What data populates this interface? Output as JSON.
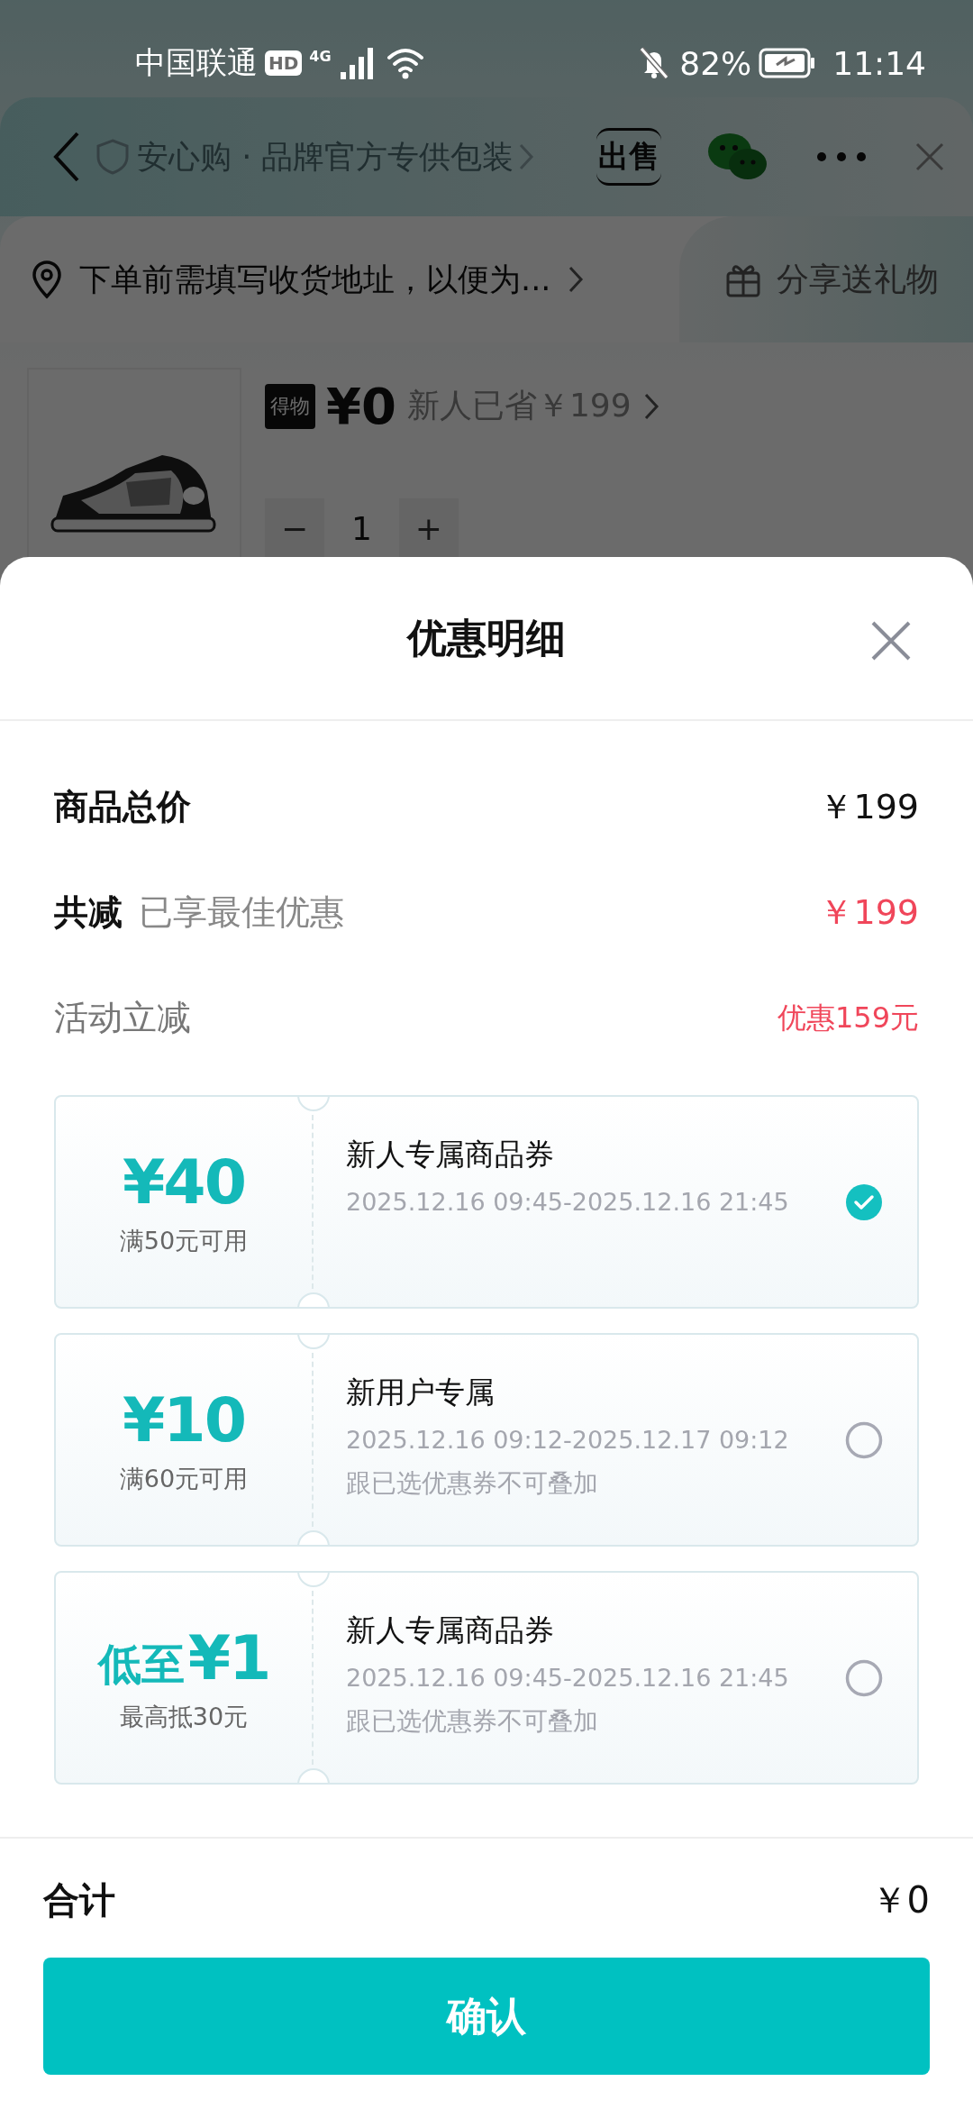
{
  "status_bar": {
    "carrier": "中国联通",
    "hd": "HD",
    "network": "4G",
    "battery": "82%",
    "time": "11:14"
  },
  "header": {
    "badge_text": "安心购 · 品牌官方专供包装",
    "sell_label": "出售"
  },
  "address_bar": {
    "text": "下单前需填写收货地址，以便为...",
    "share": "分享送礼物"
  },
  "product": {
    "brand_logo": "得物",
    "price": "¥0",
    "saved": "新人已省￥199",
    "minus": "−",
    "quantity": "1",
    "plus": "+"
  },
  "sheet": {
    "title": "优惠明细",
    "summary": [
      {
        "kind": "total",
        "label": "商品总价",
        "value": "￥199"
      },
      {
        "kind": "discount",
        "label": "共减",
        "note": "已享最佳优惠",
        "value": "￥199"
      },
      {
        "kind": "activity",
        "label": "活动立减",
        "value": "优惠159元"
      }
    ],
    "coupons": [
      {
        "amount": "¥40",
        "condition": "满50元可用",
        "title": "新人专属商品券",
        "period": "2025.12.16 09:45-2025.12.16 21:45",
        "selected": true
      },
      {
        "amount": "¥10",
        "condition": "满60元可用",
        "title": "新用户专属",
        "period": "2025.12.16 09:12-2025.12.17 09:12",
        "note": "跟已选优惠券不可叠加",
        "selected": false
      },
      {
        "prefix": "低至",
        "amount": "¥1",
        "condition": "最高抵30元",
        "title": "新人专属商品券",
        "period": "2025.12.16 09:45-2025.12.16 21:45",
        "note": "跟已选优惠券不可叠加",
        "selected": false
      }
    ],
    "footer": {
      "total_label": "合计",
      "total_value": "￥0",
      "confirm": "确认"
    }
  }
}
